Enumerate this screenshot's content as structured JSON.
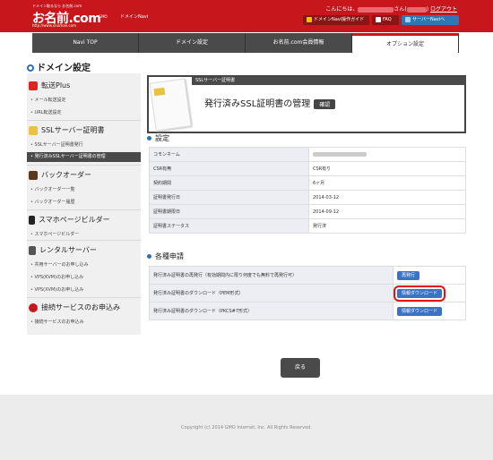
{
  "header": {
    "logo_tagline": "ドメイン取るなら お名前.com",
    "logo_text": "お名前.com",
    "logo_url": "http://www.onamae.com",
    "gmo": "GMO",
    "service_name": "ドメインNavi",
    "greeting_prefix": "こんにちは、",
    "greeting_mid": "さん(",
    "greeting_suffix": ")",
    "logout": "ログアウト",
    "guide_btn": "ドメインNavi操作ガイド",
    "faq_btn": "FAQ",
    "navi_btn": "サーバーNaviへ"
  },
  "tabs": [
    "Navi TOP",
    "ドメイン設定",
    "お名前.com会員情報",
    "オプション設定"
  ],
  "page_title": "ドメイン設定",
  "sidebar": {
    "groups": [
      {
        "label": "転送Plus",
        "items": [
          "メール転送設定",
          "URL転送設定"
        ]
      },
      {
        "label": "SSLサーバー証明書",
        "items": [
          "SSLサーバー証明書発行",
          "発行済みSSLサーバー証明書の管理"
        ]
      },
      {
        "label": "バックオーダー",
        "items": [
          "バックオーダー一覧",
          "バックオーダー履歴"
        ]
      },
      {
        "label": "スマホページビルダー",
        "items": [
          "スマホページビルダー"
        ]
      },
      {
        "label": "レンタルサーバー",
        "items": [
          "共用サーバーのお申し込み",
          "VPS(KVM)のお申し込み",
          "VPS(XVM)のお申し込み"
        ]
      },
      {
        "label": "接続サービスのお申込み",
        "items": [
          "接続サービスのお申込み"
        ]
      }
    ]
  },
  "panel": {
    "bar": "SSLサーバー証明書",
    "title": "発行済みSSL証明書の管理",
    "badge": "確認"
  },
  "settings": {
    "heading": "設定",
    "rows": [
      {
        "key": "コモンネーム",
        "value": ""
      },
      {
        "key": "CSR有無",
        "value": "CSR有り"
      },
      {
        "key": "契約期間",
        "value": "6ヶ月"
      },
      {
        "key": "証明書発行日",
        "value": "2014-03-12"
      },
      {
        "key": "証明書期限日",
        "value": "2014-09-12"
      },
      {
        "key": "証明書ステータス",
        "value": "発行済"
      }
    ]
  },
  "apply": {
    "heading": "各種申請",
    "rows": [
      {
        "label": "発行済み証明書の再発行（有効期間内に限り何度でも無料で再発行可）",
        "button": "再発行"
      },
      {
        "label": "発行済み証明書のダウンロード（PEM形式）",
        "button": "情報ダウンロード"
      },
      {
        "label": "発行済み証明書のダウンロード（PKCS#7形式）",
        "button": "情報ダウンロード"
      }
    ]
  },
  "back_button": "戻る",
  "copyright": "Copyright (c) 2014 GMO Internet, Inc. All Rights Reserved.",
  "colors": {
    "brand_red": "#c8161d",
    "dark": "#4a4a4a",
    "accent_blue": "#3a73c5",
    "highlight": "#e01018"
  }
}
